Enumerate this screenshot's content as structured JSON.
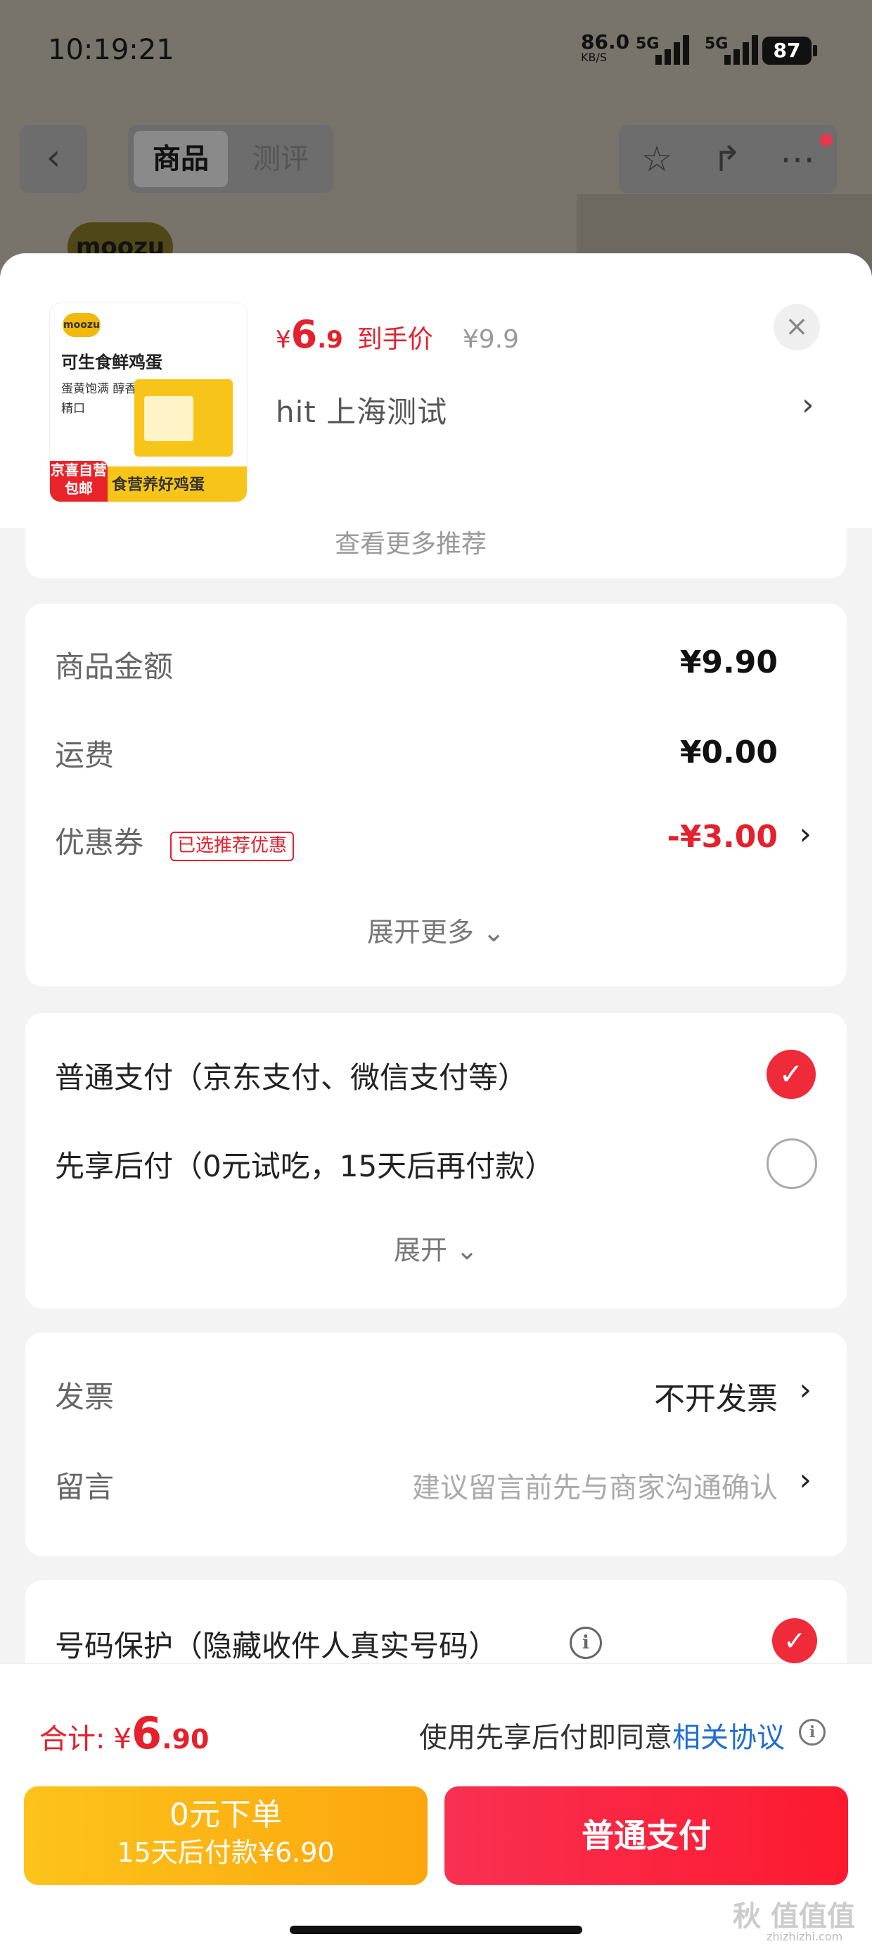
{
  "status": {
    "time": "10:19:21",
    "net_speed": "86.0",
    "net_unit": "KB/S",
    "sig1": "5G",
    "sig2": "5G",
    "battery": "87"
  },
  "nav": {
    "back_icon": "chevron-left-icon",
    "tab_product": "商品",
    "tab_review": "测评",
    "icons": [
      "star-icon",
      "share-icon",
      "more-icon"
    ],
    "brand": "moozu"
  },
  "product": {
    "image_logo": "moozu",
    "image_title": "可生食鲜鸡蛋",
    "image_sub": "蛋黄饱满 醇香精口",
    "image_tag": "京喜自营 包邮",
    "image_band": "食营养好鸡蛋",
    "price_symbol": "¥",
    "price_int": "6",
    "price_dec": ".9",
    "price_label": "到手价",
    "price_original": "¥9.9",
    "address": "hit  上海测试",
    "close": "×"
  },
  "partial_text": "查看更多推荐",
  "amounts": {
    "goods_label": "商品金额",
    "goods_value": "¥9.90",
    "shipping_label": "运费",
    "shipping_value": "¥0.00",
    "coupon_label": "优惠券",
    "coupon_tag": "已选推荐优惠",
    "coupon_value": "-¥3.00",
    "expand_more": "展开更多"
  },
  "payment": {
    "normal": "普通支付（京东支付、微信支付等）",
    "later": "先享后付（0元试吃，15天后再付款）",
    "expand": "展开",
    "normal_selected": true,
    "later_selected": false
  },
  "invoice": {
    "label": "发票",
    "value": "不开发票",
    "message_label": "留言",
    "message_placeholder": "建议留言前先与商家沟通确认"
  },
  "privacy": {
    "label": "号码保护（隐藏收件人真实号码）",
    "selected": true
  },
  "footer": {
    "total_label": "合计:",
    "total_symbol": "¥",
    "total_int": "6",
    "total_dec": ".90",
    "agree_text": "使用先享后付即同意",
    "agree_link": "相关协议",
    "btn_zero_line1": "0元下单",
    "btn_zero_line2": "15天后付款¥6.90",
    "btn_normal": "普通支付",
    "watermark": "秋 值值值",
    "watermark_sub": "zhizhizhi.com"
  },
  "colors": {
    "accent_red": "#e4212c",
    "yellow_button": "#fdc31b",
    "link_blue": "#1f6fd0"
  }
}
